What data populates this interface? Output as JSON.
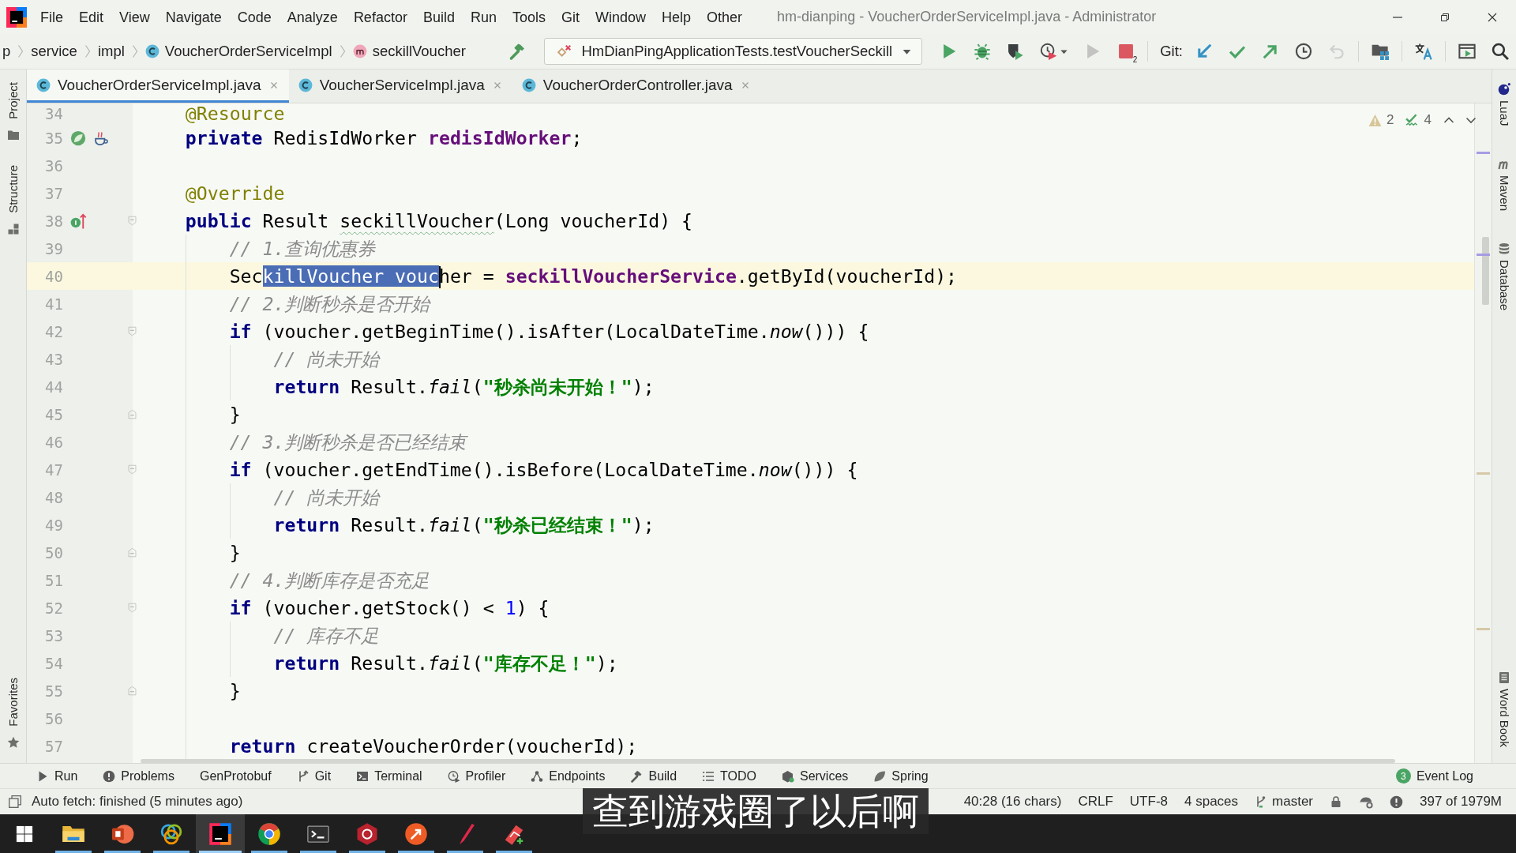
{
  "window": {
    "title": "hm-dianping - VoucherOrderServiceImpl.java - Administrator"
  },
  "menu": [
    "File",
    "Edit",
    "View",
    "Navigate",
    "Code",
    "Analyze",
    "Refactor",
    "Build",
    "Run",
    "Tools",
    "Git",
    "Window",
    "Help",
    "Other"
  ],
  "breadcrumbs": [
    {
      "kind": "package",
      "label": "p"
    },
    {
      "kind": "package",
      "label": "service"
    },
    {
      "kind": "package",
      "label": "impl"
    },
    {
      "kind": "class",
      "label": "VoucherOrderServiceImpl"
    },
    {
      "kind": "method",
      "label": "seckillVoucher"
    }
  ],
  "toolbar": [
    {
      "kind": "build",
      "disabled": false
    },
    {
      "kind": "run-config",
      "label": "HmDianPingApplicationTests.testVoucherSeckill"
    },
    {
      "kind": "run",
      "disabled": false
    },
    {
      "kind": "debug",
      "disabled": false
    },
    {
      "kind": "coverage",
      "disabled": false
    },
    {
      "kind": "profile",
      "disabled": false
    },
    {
      "kind": "rerun",
      "disabled": true
    },
    {
      "kind": "stop",
      "disabled": false,
      "badge": "2"
    },
    {
      "kind": "separator"
    },
    {
      "kind": "label",
      "label": "Git:"
    },
    {
      "kind": "vcs-update",
      "disabled": false
    },
    {
      "kind": "vcs-commit",
      "disabled": false
    },
    {
      "kind": "vcs-push",
      "disabled": false
    },
    {
      "kind": "vcs-history",
      "disabled": false
    },
    {
      "kind": "vcs-rollback",
      "disabled": true
    },
    {
      "kind": "separator"
    },
    {
      "kind": "project-structure",
      "disabled": false
    },
    {
      "kind": "separator"
    },
    {
      "kind": "translate",
      "disabled": false
    },
    {
      "kind": "separator"
    },
    {
      "kind": "preview",
      "disabled": false
    },
    {
      "kind": "search",
      "disabled": false
    }
  ],
  "tabs": [
    {
      "label": "VoucherOrderServiceImpl.java",
      "selected": true
    },
    {
      "label": "VoucherServiceImpl.java",
      "selected": false
    },
    {
      "label": "VoucherOrderController.java",
      "selected": false
    }
  ],
  "left_strip": {
    "top": [
      {
        "kind": "project",
        "label": "Project"
      },
      {
        "kind": "structure",
        "label": "Structure"
      }
    ],
    "bottom": [
      {
        "kind": "favorites",
        "label": "Favorites"
      }
    ]
  },
  "right_strip": {
    "top": [
      {
        "kind": "luaj",
        "label": "LuaJ"
      },
      {
        "kind": "maven",
        "label": "Maven"
      },
      {
        "kind": "database",
        "label": "Database"
      }
    ],
    "bottom": [
      {
        "kind": "wordbook",
        "label": "Word Book"
      }
    ]
  },
  "editor": {
    "inspections": {
      "warnings": "2",
      "weak_warnings": "4"
    },
    "lines": [
      {
        "number": "34",
        "current": false,
        "tokens": [
          {
            "kind": "annotation",
            "text": "@Resource"
          }
        ]
      },
      {
        "number": "35",
        "current": false,
        "markers": [
          {
            "kind": "bean"
          },
          {
            "kind": "java"
          }
        ],
        "tokens": [
          {
            "kind": "keyword",
            "text": "private"
          },
          {
            "kind": "plain",
            "text": " RedisIdWorker "
          },
          {
            "kind": "field",
            "text": "redisIdWorker"
          },
          {
            "kind": "plain",
            "text": ";"
          }
        ]
      },
      {
        "number": "36",
        "current": false
      },
      {
        "number": "37",
        "current": false,
        "tokens": [
          {
            "kind": "annotation",
            "text": "@Override"
          }
        ]
      },
      {
        "number": "38",
        "current": false,
        "markers": [
          {
            "kind": "implements"
          }
        ],
        "fold": {
          "kind": "start"
        },
        "tokens": [
          {
            "kind": "keyword",
            "text": "public"
          },
          {
            "kind": "plain",
            "text": " Result "
          },
          {
            "kind": "typo",
            "text": "seckillVoucher"
          },
          {
            "kind": "plain",
            "text": "(Long voucherId) {"
          }
        ],
        "children": [
          {
            "number": "39",
            "current": false,
            "tokens": [
              {
                "kind": "comment",
                "text": "// 1.查询优惠券"
              }
            ]
          },
          {
            "number": "40",
            "current": true,
            "tokens": [
              {
                "kind": "plain",
                "text": "Sec"
              },
              {
                "kind": "selection",
                "text": "killVoucher vouc"
              },
              {
                "kind": "caret"
              },
              {
                "kind": "plain",
                "text": "her = "
              },
              {
                "kind": "field",
                "text": "seckillVoucherService"
              },
              {
                "kind": "plain",
                "text": ".getById(voucherId);"
              }
            ]
          },
          {
            "number": "41",
            "current": false,
            "tokens": [
              {
                "kind": "comment",
                "text": "// 2.判断秒杀是否开始"
              }
            ]
          },
          {
            "number": "42",
            "current": false,
            "fold": {
              "kind": "start"
            },
            "tokens": [
              {
                "kind": "keyword",
                "text": "if"
              },
              {
                "kind": "plain",
                "text": " (voucher.getBeginTime().isAfter(LocalDateTime."
              },
              {
                "kind": "static",
                "text": "now"
              },
              {
                "kind": "plain",
                "text": "())) {"
              }
            ],
            "children": [
              {
                "number": "43",
                "current": false,
                "tokens": [
                  {
                    "kind": "comment",
                    "text": "// 尚未开始"
                  }
                ]
              },
              {
                "number": "44",
                "current": false,
                "tokens": [
                  {
                    "kind": "keyword",
                    "text": "return"
                  },
                  {
                    "kind": "plain",
                    "text": " Result."
                  },
                  {
                    "kind": "static",
                    "text": "fail"
                  },
                  {
                    "kind": "plain",
                    "text": "("
                  },
                  {
                    "kind": "string",
                    "text": "\"秒杀尚未开始！\""
                  },
                  {
                    "kind": "plain",
                    "text": ");"
                  }
                ]
              }
            ]
          },
          {
            "number": "45",
            "current": false,
            "fold": {
              "kind": "end"
            },
            "tokens": [
              {
                "kind": "plain",
                "text": "}"
              }
            ]
          },
          {
            "number": "46",
            "current": false,
            "tokens": [
              {
                "kind": "comment",
                "text": "// 3.判断秒杀是否已经结束"
              }
            ]
          },
          {
            "number": "47",
            "current": false,
            "fold": {
              "kind": "start"
            },
            "tokens": [
              {
                "kind": "keyword",
                "text": "if"
              },
              {
                "kind": "plain",
                "text": " (voucher.getEndTime().isBefore(LocalDateTime."
              },
              {
                "kind": "static",
                "text": "now"
              },
              {
                "kind": "plain",
                "text": "())) {"
              }
            ],
            "children": [
              {
                "number": "48",
                "current": false,
                "tokens": [
                  {
                    "kind": "comment",
                    "text": "// 尚未开始"
                  }
                ]
              },
              {
                "number": "49",
                "current": false,
                "tokens": [
                  {
                    "kind": "keyword",
                    "text": "return"
                  },
                  {
                    "kind": "plain",
                    "text": " Result."
                  },
                  {
                    "kind": "static",
                    "text": "fail"
                  },
                  {
                    "kind": "plain",
                    "text": "("
                  },
                  {
                    "kind": "string",
                    "text": "\"秒杀已经结束！\""
                  },
                  {
                    "kind": "plain",
                    "text": ");"
                  }
                ]
              }
            ]
          },
          {
            "number": "50",
            "current": false,
            "fold": {
              "kind": "end"
            },
            "tokens": [
              {
                "kind": "plain",
                "text": "}"
              }
            ]
          },
          {
            "number": "51",
            "current": false,
            "tokens": [
              {
                "kind": "comment",
                "text": "// 4.判断库存是否充足"
              }
            ]
          },
          {
            "number": "52",
            "current": false,
            "fold": {
              "kind": "start"
            },
            "tokens": [
              {
                "kind": "keyword",
                "text": "if"
              },
              {
                "kind": "plain",
                "text": " (voucher.getStock() < "
              },
              {
                "kind": "number",
                "text": "1"
              },
              {
                "kind": "plain",
                "text": ") {"
              }
            ],
            "children": [
              {
                "number": "53",
                "current": false,
                "tokens": [
                  {
                    "kind": "comment",
                    "text": "// 库存不足"
                  }
                ]
              },
              {
                "number": "54",
                "current": false,
                "tokens": [
                  {
                    "kind": "keyword",
                    "text": "return"
                  },
                  {
                    "kind": "plain",
                    "text": " Result."
                  },
                  {
                    "kind": "static",
                    "text": "fail"
                  },
                  {
                    "kind": "plain",
                    "text": "("
                  },
                  {
                    "kind": "string",
                    "text": "\"库存不足！\""
                  },
                  {
                    "kind": "plain",
                    "text": ");"
                  }
                ]
              }
            ]
          },
          {
            "number": "55",
            "current": false,
            "fold": {
              "kind": "end"
            },
            "tokens": [
              {
                "kind": "plain",
                "text": "}"
              }
            ]
          },
          {
            "number": "56",
            "current": false
          },
          {
            "number": "57",
            "current": false,
            "tokens": [
              {
                "kind": "keyword",
                "text": "return"
              },
              {
                "kind": "plain",
                "text": " createVoucherOrder(voucherId);"
              }
            ]
          }
        ]
      }
    ]
  },
  "tool_windows": {
    "left": [
      {
        "kind": "run",
        "label": "Run"
      },
      {
        "kind": "problems",
        "label": "Problems"
      },
      {
        "kind": "plain",
        "label": "GenProtobuf"
      },
      {
        "kind": "git",
        "label": "Git"
      },
      {
        "kind": "terminal",
        "label": "Terminal"
      },
      {
        "kind": "profiler",
        "label": "Profiler"
      },
      {
        "kind": "endpoints",
        "label": "Endpoints"
      },
      {
        "kind": "build",
        "label": "Build"
      },
      {
        "kind": "todo",
        "label": "TODO"
      },
      {
        "kind": "services",
        "label": "Services"
      },
      {
        "kind": "spring",
        "label": "Spring"
      }
    ],
    "right": [
      {
        "label": "Event Log",
        "badge": "3"
      }
    ]
  },
  "status_bar": {
    "message": "Auto fetch: finished (5 minutes ago)",
    "items": [
      {
        "kind": "text",
        "label": "40:28 (16 chars)"
      },
      {
        "kind": "text",
        "label": "CRLF"
      },
      {
        "kind": "text",
        "label": "UTF-8"
      },
      {
        "kind": "text",
        "label": "4 spaces"
      },
      {
        "kind": "branch",
        "label": "master"
      },
      {
        "kind": "lock"
      },
      {
        "kind": "inspector"
      },
      {
        "kind": "alert"
      },
      {
        "kind": "text",
        "label": "397 of 1979M"
      }
    ]
  },
  "taskbar": {
    "apps": [
      {
        "kind": "folder",
        "running": true,
        "active": false
      },
      {
        "kind": "presentation",
        "running": true,
        "active": false
      },
      {
        "kind": "rings",
        "running": true,
        "active": false
      },
      {
        "kind": "ide",
        "running": true,
        "active": true
      },
      {
        "kind": "browser",
        "running": true,
        "active": false
      },
      {
        "kind": "terminal",
        "running": true,
        "active": false
      },
      {
        "kind": "database",
        "running": true,
        "active": false
      },
      {
        "kind": "api-client",
        "running": true,
        "active": false
      },
      {
        "kind": "pen",
        "running": true,
        "active": false
      },
      {
        "kind": "paint",
        "running": true,
        "active": false
      }
    ]
  },
  "subtitle": "查到游戏圈了以后啊"
}
